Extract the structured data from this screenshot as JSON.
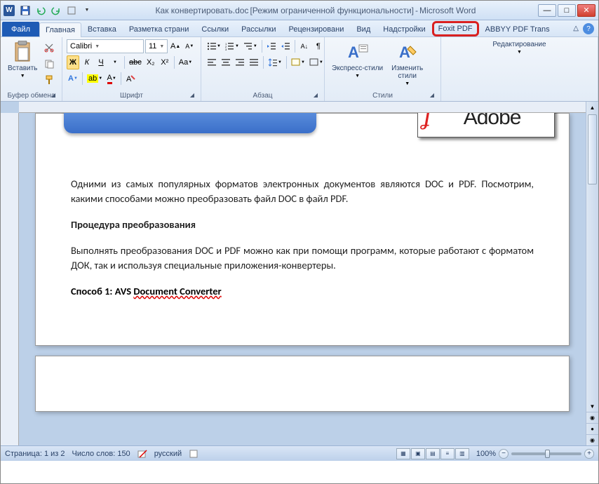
{
  "title": {
    "word_icon": "W",
    "doc_name": "Как конвертировать.doc",
    "compat": "[Режим ограниченной функциональности]",
    "app": "Microsoft Word"
  },
  "tabs": {
    "file": "Файл",
    "home": "Главная",
    "insert": "Вставка",
    "pagelayout": "Разметка страни",
    "references": "Ссылки",
    "mailings": "Рассылки",
    "review": "Рецензировани",
    "view": "Вид",
    "addins": "Надстройки",
    "foxit": "Foxit PDF",
    "abbyy": "ABBYY PDF Trans"
  },
  "ribbon": {
    "clipboard": {
      "label": "Буфер обмена",
      "paste": "Вставить"
    },
    "font": {
      "label": "Шрифт",
      "name": "Calibri",
      "size": "11",
      "bold": "Ж",
      "italic": "К",
      "underline": "Ч",
      "strike": "abc",
      "sub": "X₂",
      "sup": "X²"
    },
    "paragraph": {
      "label": "Абзац"
    },
    "styles": {
      "label": "Стили",
      "quick": "Экспресс-стили",
      "change": "Изменить\nстили"
    },
    "editing": {
      "label": "Редактирование"
    }
  },
  "document": {
    "adobe": "Adobe",
    "p1": "Одними из самых популярных форматов электронных документов являются DOC и PDF. Посмотрим, какими способами можно преобразовать файл DOC в файл PDF.",
    "p2": "Процедура преобразования",
    "p3": "Выполнять преобразования DOC и PDF можно как при помощи программ, которые работают с форматом ДОК, так и используя специальные приложения-конвертеры.",
    "p4_label": "Способ 1: AVS ",
    "p4_link": "Document Converter"
  },
  "status": {
    "page": "Страница: 1 из 2",
    "words": "Число слов: 150",
    "lang": "русский",
    "zoom": "100%"
  }
}
